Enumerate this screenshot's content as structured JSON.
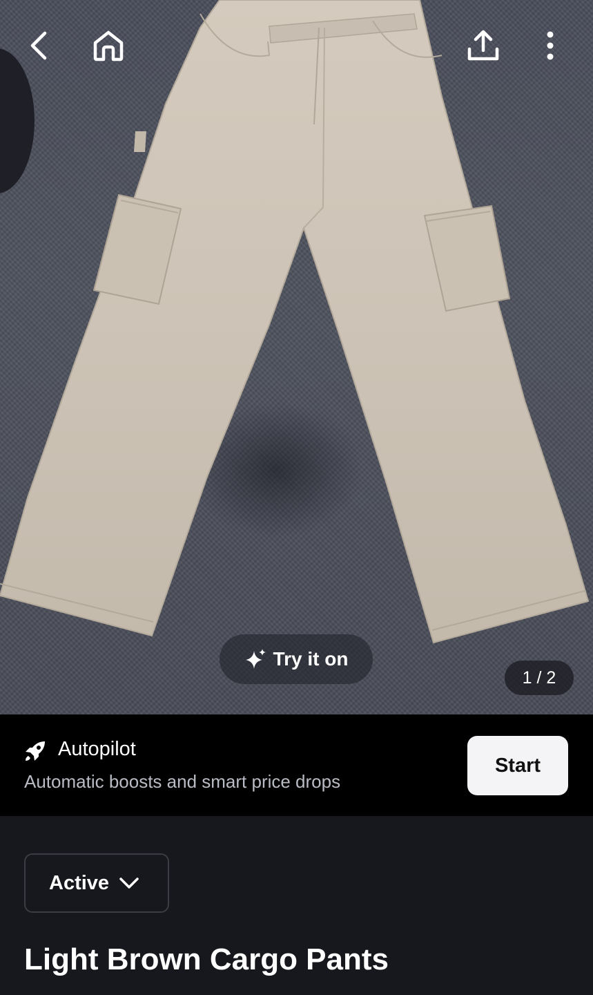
{
  "header": {
    "back_icon": "chevron-left-icon",
    "home_icon": "home-icon",
    "share_icon": "share-upload-icon",
    "more_icon": "more-vertical-icon"
  },
  "photo": {
    "try_on_label": "Try it on",
    "try_on_icon": "sparkle-icon",
    "counter": "1 / 2"
  },
  "autopilot": {
    "icon": "rocket-icon",
    "title": "Autopilot",
    "subtitle": "Automatic boosts and smart price drops",
    "button_label": "Start"
  },
  "listing": {
    "status": "Active",
    "status_icon": "chevron-down-icon",
    "title": "Light Brown Cargo Pants"
  }
}
